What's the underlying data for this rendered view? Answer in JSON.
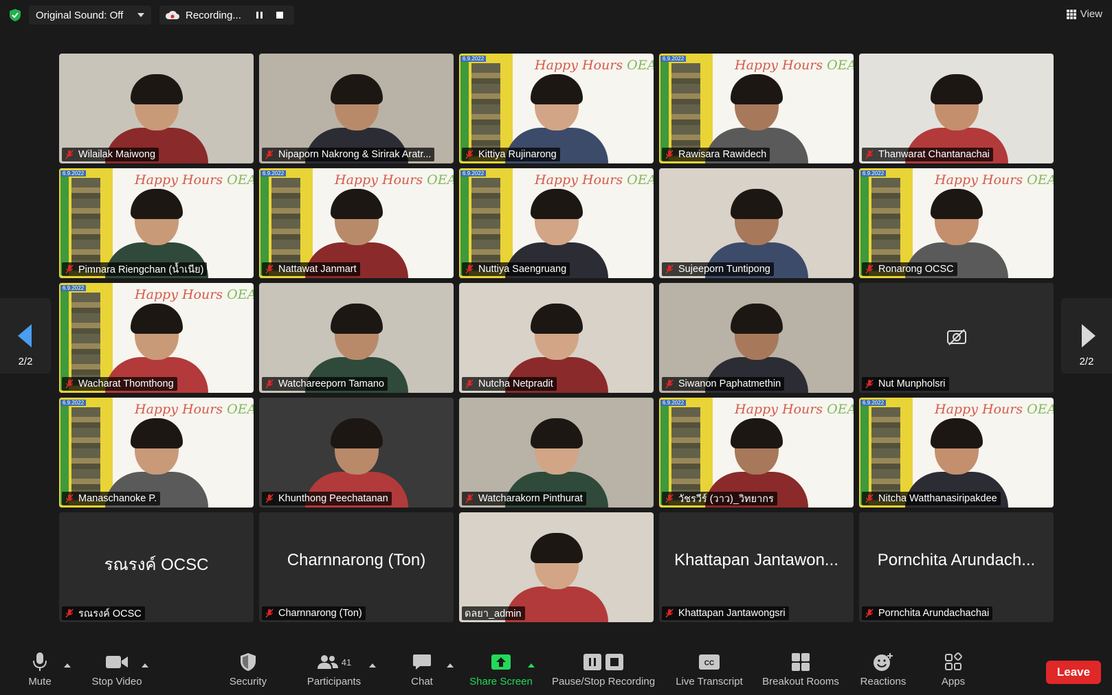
{
  "top_bar": {
    "original_sound": "Original Sound: Off",
    "recording": "Recording...",
    "view": "View"
  },
  "pagination": {
    "left": "2/2",
    "right": "2/2"
  },
  "participants": [
    {
      "name": "Wilailak Maiwong",
      "bg": "room"
    },
    {
      "name": "Nipaporn Nakrong & Sirirak Aratr...",
      "bg": "room2"
    },
    {
      "name": "Kittiya Rujinarong",
      "bg": "oea"
    },
    {
      "name": "Rawisara Rawidech",
      "bg": "oea"
    },
    {
      "name": "Thanwarat Chantanachai",
      "bg": "win"
    },
    {
      "name": "Pimnara Riengchan (น้ำเนีย)",
      "bg": "oea"
    },
    {
      "name": "Nattawat Janmart",
      "bg": "oea"
    },
    {
      "name": "Nuttiya Saengruang",
      "bg": "oea"
    },
    {
      "name": "Sujeeporn Tuntipong",
      "bg": "room3"
    },
    {
      "name": "Ronarong OCSC",
      "bg": "oea"
    },
    {
      "name": "Wacharat Thomthong",
      "bg": "oea"
    },
    {
      "name": "Watchareeporn Tamano",
      "bg": "room"
    },
    {
      "name": "Nutcha Netpradit",
      "bg": "room3"
    },
    {
      "name": "Siwanon Paphatmethin",
      "bg": "room2"
    },
    {
      "name": "Nut Munpholsri",
      "bg": "off"
    },
    {
      "name": "Manaschanoke P.",
      "bg": "oea"
    },
    {
      "name": "Khunthong Peechatanan",
      "bg": "car"
    },
    {
      "name": "Watcharakorn Pinthurat",
      "bg": "room2"
    },
    {
      "name": "วัชรวีร์ (วาว)_วิทยากร",
      "bg": "oea"
    },
    {
      "name": "Nitcha Watthanasiripakdee",
      "bg": "oea"
    },
    {
      "name": "รณรงค์ OCSC",
      "bg": "name",
      "display": "รณรงค์ OCSC"
    },
    {
      "name": "Charnnarong (Ton)",
      "bg": "name",
      "display": "Charnnarong (Ton)"
    },
    {
      "name": "ดลยา_admin",
      "bg": "room3",
      "unmuted": true
    },
    {
      "name": "Khattapan Jantawongsri",
      "bg": "name",
      "display": "Khattapan Jantawon..."
    },
    {
      "name": "Pornchita Arundachachai",
      "bg": "name",
      "display": "Pornchita Arundach..."
    }
  ],
  "backdrop": {
    "banner": "Happy Hours",
    "org": "OEA",
    "date": "6.9.2022"
  },
  "toolbar": {
    "mute": "Mute",
    "stop_video": "Stop Video",
    "security": "Security",
    "participants": "Participants",
    "participant_count": "41",
    "chat": "Chat",
    "share_screen": "Share Screen",
    "pause_stop_recording": "Pause/Stop Recording",
    "live_transcript": "Live Transcript",
    "breakout_rooms": "Breakout Rooms",
    "reactions": "Reactions",
    "apps": "Apps",
    "leave": "Leave"
  },
  "colors": {
    "share_green": "#23d959",
    "leave_red": "#e02828",
    "nav_blue": "#4a9df0"
  }
}
